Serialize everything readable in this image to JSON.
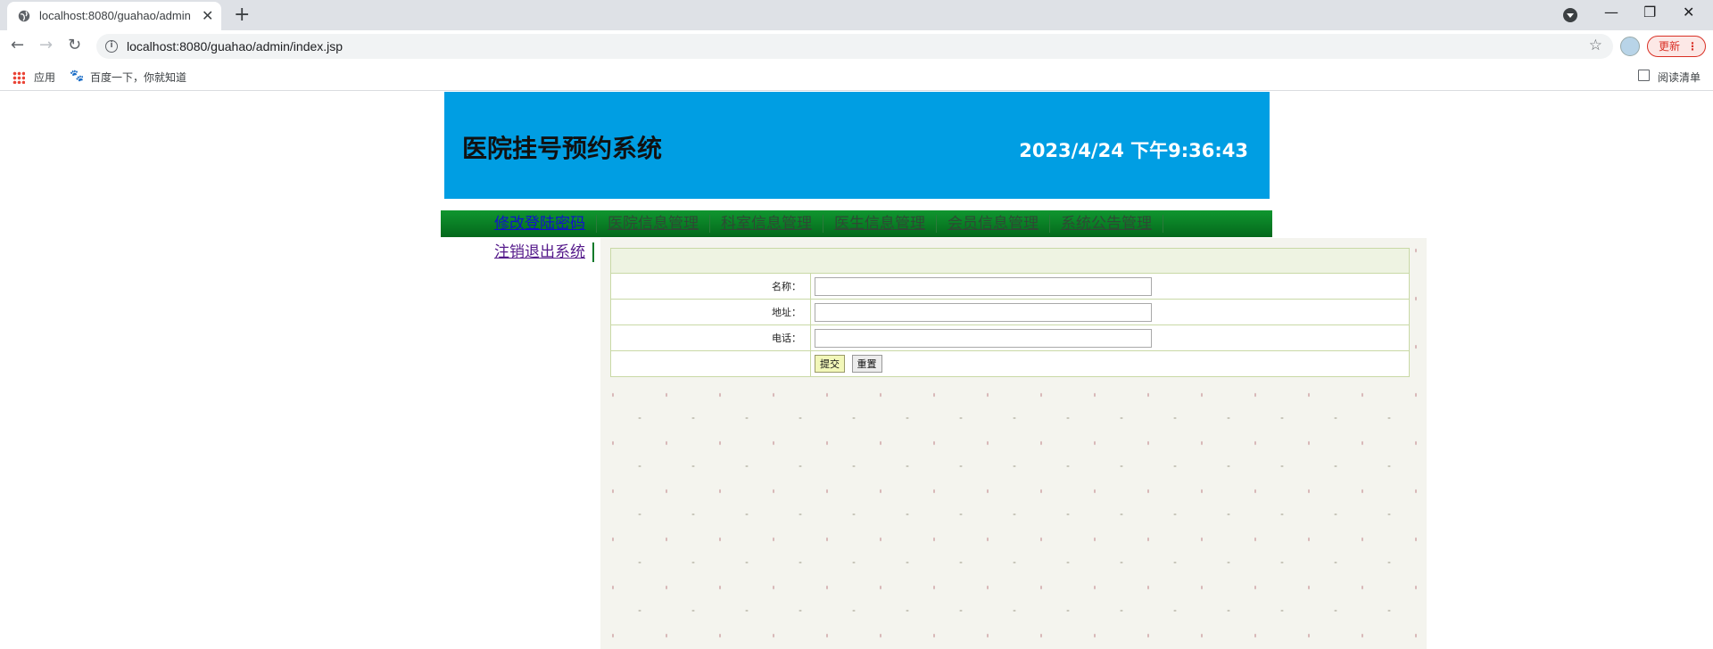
{
  "browser": {
    "tab_title": "localhost:8080/guahao/admin",
    "tab_close": "✕",
    "new_tab": "+",
    "url": "localhost:8080/guahao/admin/index.jsp",
    "update_label": "更新",
    "window_controls": {
      "minimize": "—",
      "restore": "❐",
      "close": "✕"
    },
    "bookmarks": [
      {
        "label": "应用",
        "icon": "apps-icon"
      },
      {
        "label": "百度一下，你就知道",
        "icon": "baidu-paw-icon"
      }
    ],
    "reading_list": "阅读清单"
  },
  "header": {
    "site_title": "医院挂号预约系统",
    "clock": "2023/4/24 下午9:36:43",
    "background_color": "#009ee3"
  },
  "nav": {
    "items": [
      {
        "label": "修改登陆密码",
        "active": true
      },
      {
        "label": "医院信息管理"
      },
      {
        "label": "科室信息管理"
      },
      {
        "label": "医生信息管理"
      },
      {
        "label": "会员信息管理"
      },
      {
        "label": "系统公告管理"
      }
    ],
    "logout_label": "注销退出系统"
  },
  "form": {
    "name_label": "名称：",
    "address_label": "地址：",
    "phone_label": "电话：",
    "name_value": "",
    "address_value": "",
    "phone_value": "",
    "submit_label": "提交",
    "reset_label": "重置"
  }
}
